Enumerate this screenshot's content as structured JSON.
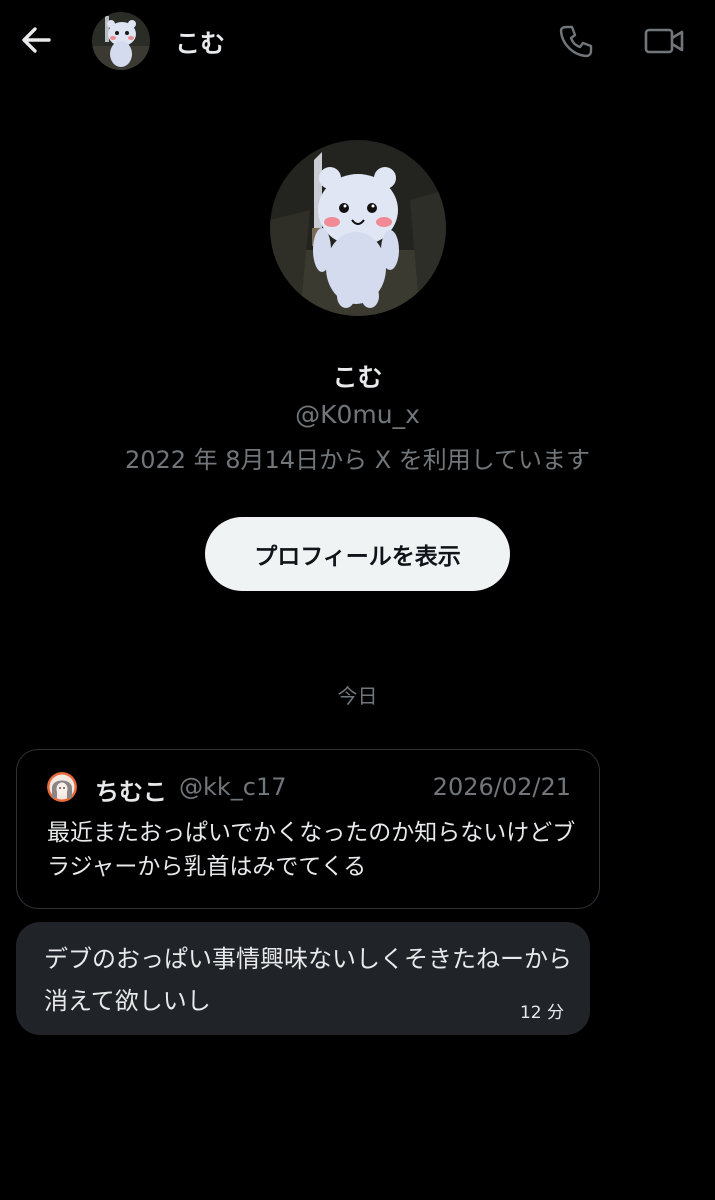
{
  "header": {
    "name": "こむ",
    "back_icon": "back-arrow-icon",
    "call_icon": "phone-icon",
    "video_icon": "video-camera-icon"
  },
  "profile": {
    "name": "こむ",
    "handle": "@K0mu_x",
    "joined": "2022 年 8月14日から X を利用しています",
    "view_profile_label": "プロフィールを表示"
  },
  "conversation": {
    "date_divider": "今日",
    "quoted_post": {
      "author_name": "ちむこ",
      "author_handle": "@kk_c17",
      "date": "2026/02/21",
      "text": "最近またおっぱいでかくなったのか知らないけどブラジャーから乳首はみでてくる"
    },
    "message": {
      "text": "デブのおっぱい事情興味ないしくそきたねーから消えて欲しいし",
      "time": "12 分"
    }
  },
  "colors": {
    "background": "#000000",
    "primary_text": "#e7e9ea",
    "secondary_text": "#71767b",
    "bubble": "#202327",
    "border": "#2f3336",
    "button_bg": "#eff3f4"
  }
}
